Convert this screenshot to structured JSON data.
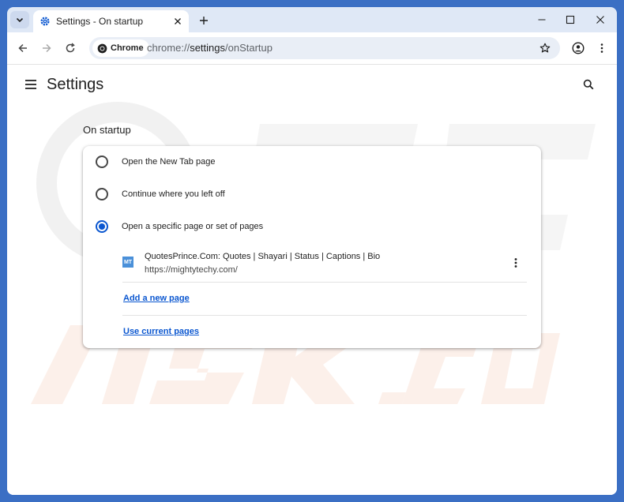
{
  "browser": {
    "tab": {
      "title": "Settings - On startup",
      "icon": "settings-gear-icon"
    },
    "chip_label": "Chrome",
    "url_scheme": "chrome://",
    "url_host": "settings",
    "url_path": "/onStartup"
  },
  "settings": {
    "title": "Settings",
    "section_title": "On startup",
    "options": [
      {
        "label": "Open the New Tab page",
        "checked": false
      },
      {
        "label": "Continue where you left off",
        "checked": false
      },
      {
        "label": "Open a specific page or set of pages",
        "checked": true
      }
    ],
    "page_entry": {
      "favicon_text": "MT",
      "title": "QuotesPrince.Com: Quotes | Shayari | Status | Captions | Bio",
      "url": "https://mightytechy.com/"
    },
    "add_page_link": "Add a new page",
    "use_current_link": "Use current pages"
  },
  "colors": {
    "accent": "#0b57d0",
    "frame": "#dfe8f6",
    "desktop": "#3b6fc4"
  }
}
